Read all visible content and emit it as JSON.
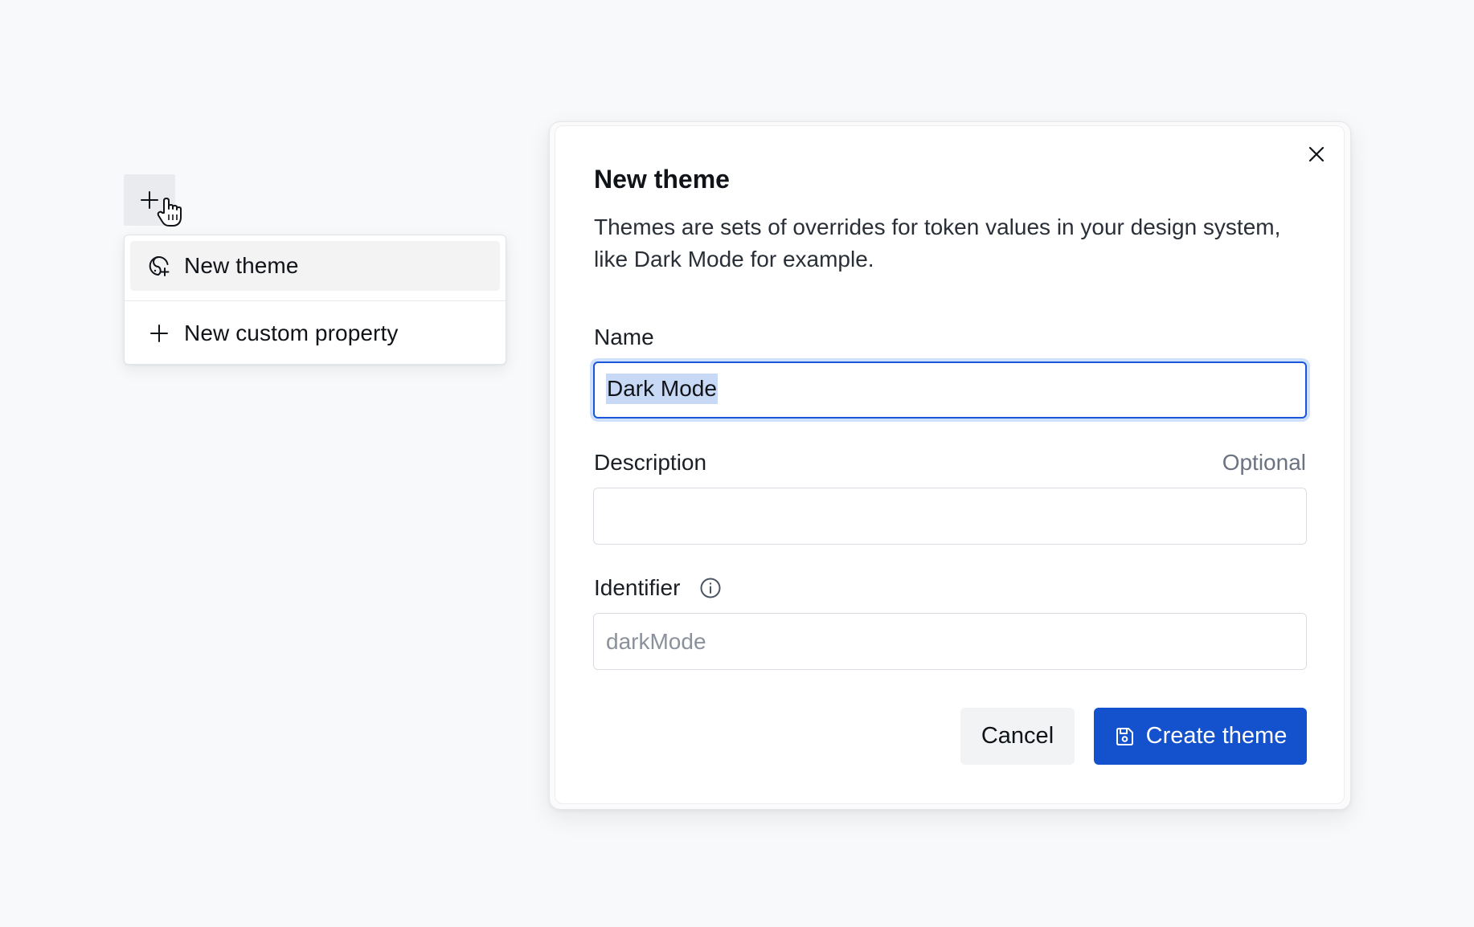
{
  "add_button": {
    "icon": "plus-icon"
  },
  "dropdown": {
    "items": [
      {
        "label": "New theme",
        "icon": "theme-add-icon",
        "active": true
      },
      {
        "label": "New custom property",
        "icon": "plus-icon",
        "active": false
      }
    ]
  },
  "dialog": {
    "title": "New theme",
    "description": "Themes are sets of overrides for token values in your design system, like Dark Mode for example.",
    "close_icon": "close-icon",
    "fields": {
      "name": {
        "label": "Name",
        "value": "Dark Mode"
      },
      "description": {
        "label": "Description",
        "hint": "Optional",
        "value": ""
      },
      "identifier": {
        "label": "Identifier",
        "info_icon": "info-icon",
        "placeholder": "darkMode"
      }
    },
    "buttons": {
      "cancel": "Cancel",
      "create": "Create theme",
      "create_icon": "save-icon"
    }
  },
  "colors": {
    "primary": "#1352cc",
    "focus_ring": "#1a56db",
    "selection": "#c8d9f6",
    "background": "#f8f9fa"
  }
}
